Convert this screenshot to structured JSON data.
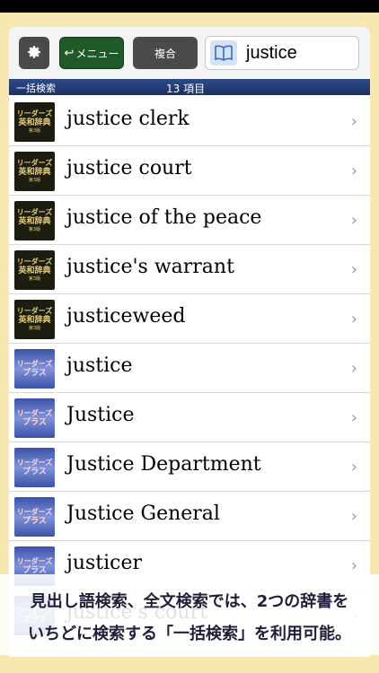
{
  "toolbar": {
    "menu_label": "メニュー",
    "compound_label": "複合",
    "search_value": "justice"
  },
  "countbar": {
    "mode_label": "一括検索",
    "count_label": "13 項目"
  },
  "thumb_text": {
    "leaders": {
      "line1": "リーダーズ",
      "line2": "英和辞典",
      "line3": "第3版"
    },
    "plus": {
      "line1": "リーダーズ",
      "line2": "プラス"
    }
  },
  "results": [
    {
      "word": "justice clerk",
      "dict": "leaders"
    },
    {
      "word": "justice court",
      "dict": "leaders"
    },
    {
      "word": "justice of the peace",
      "dict": "leaders"
    },
    {
      "word": "justice's warrant",
      "dict": "leaders"
    },
    {
      "word": "justiceweed",
      "dict": "leaders"
    },
    {
      "word": "justice",
      "dict": "plus"
    },
    {
      "word": "Justice",
      "dict": "plus"
    },
    {
      "word": "Justice Department",
      "dict": "plus"
    },
    {
      "word": "Justice General",
      "dict": "plus"
    },
    {
      "word": "justicer",
      "dict": "plus"
    },
    {
      "word": "justice's court",
      "dict": "plus"
    }
  ],
  "caption": {
    "line1": "見出し語検索、全文検索では、2つの辞書を",
    "line2": "いちどに検索する「一括検索」を利用可能。"
  },
  "colors": {
    "background": "#f7e7b0",
    "menu_button": "#1f5a28",
    "count_bar": "#1b2f63"
  }
}
